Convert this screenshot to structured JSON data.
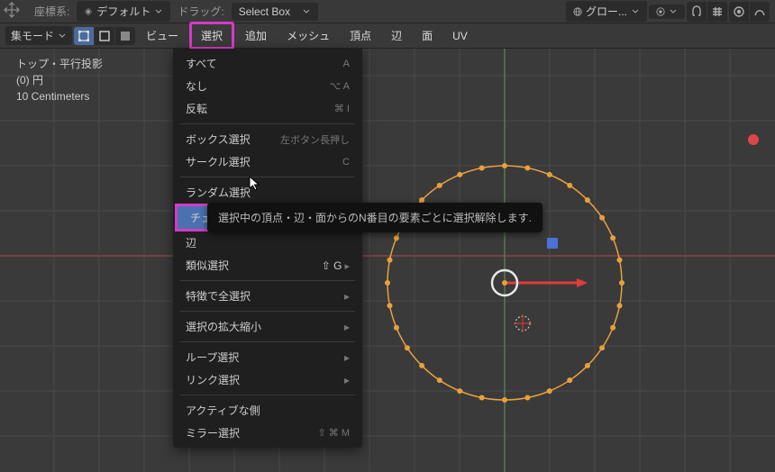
{
  "header": {
    "coord_label": "座標系:",
    "coord_value": "デフォルト",
    "drag_label": "ドラッグ:",
    "drag_value": "Select Box",
    "orientation_value": "グロー...",
    "snap_pivot": ""
  },
  "row2": {
    "mode_suffix": "集モード",
    "view": "ビュー",
    "select": "選択",
    "add": "追加",
    "mesh": "メッシュ",
    "vertex": "頂点",
    "edge": "辺",
    "face": "面",
    "uv": "UV"
  },
  "overlay": {
    "line1": "トップ・平行投影",
    "line2": "(0) 円",
    "line3": "10 Centimeters"
  },
  "menu": {
    "all": "すべて",
    "all_sc": "A",
    "none": "なし",
    "none_sc": "⌥ A",
    "invert": "反転",
    "invert_sc": "⌘ I",
    "box": "ボックス選択",
    "box_sc": "左ボタン長押し",
    "circle": "サークル選択",
    "circle_sc": "C",
    "random": "ランダム選択",
    "checker": "チェッカー選択解除",
    "sharp": "辺",
    "similar": "類似選択",
    "similar_sc": "⇧ G",
    "trait": "特徴で全選択",
    "moreless": "選択の拡大縮小",
    "loops": "ループ選択",
    "linked": "リンク選択",
    "active": "アクティブな側",
    "mirror": "ミラー選択",
    "mirror_sc": "⇧ ⌘ M"
  },
  "tooltip": "選択中の頂点・辺・面からのN番目の要素ごとに選択解除します.",
  "chart_data": {
    "type": "scatter",
    "note": "circle mesh vertices (32) in edit mode with transform gizmo",
    "vertex_count": 32,
    "radius_px": 130
  }
}
